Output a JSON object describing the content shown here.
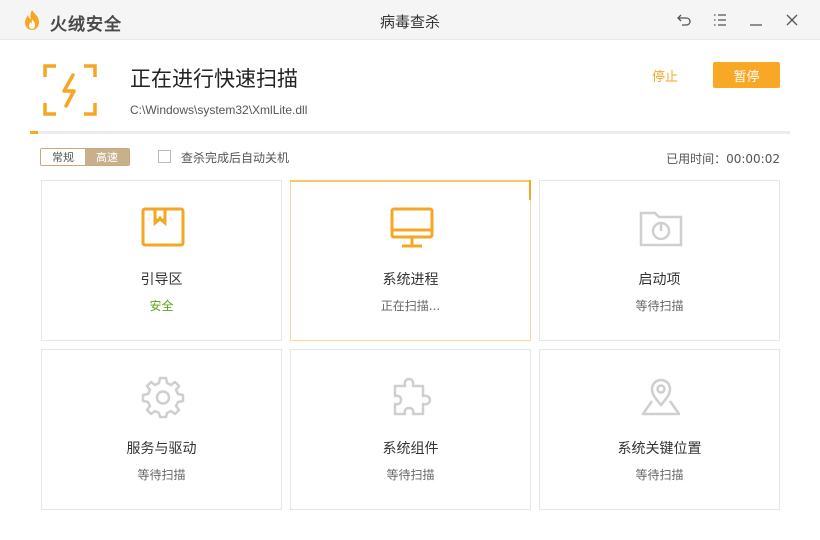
{
  "app": {
    "brand": "火绒安全",
    "window_title": "病毒查杀"
  },
  "scan": {
    "title": "正在进行快速扫描",
    "current_file": "C:\\Windows\\system32\\XmlLite.dll",
    "stop_label": "停止",
    "pause_label": "暂停",
    "progress_percent": 1
  },
  "options": {
    "mode_normal": "常规",
    "mode_fast": "高速",
    "selected_mode": "高速",
    "auto_shutdown_label": "查杀完成后自动关机",
    "auto_shutdown_checked": false,
    "elapsed_text": "已用时间：00:00:02"
  },
  "items": [
    {
      "name": "引导区",
      "status": "安全",
      "icon": "boot-sector-icon",
      "state": "safe"
    },
    {
      "name": "系统进程",
      "status": "正在扫描...",
      "icon": "monitor-icon",
      "state": "active"
    },
    {
      "name": "启动项",
      "status": "等待扫描",
      "icon": "startup-folder-icon",
      "state": "waiting"
    },
    {
      "name": "服务与驱动",
      "status": "等待扫描",
      "icon": "gear-icon",
      "state": "waiting"
    },
    {
      "name": "系统组件",
      "status": "等待扫描",
      "icon": "puzzle-icon",
      "state": "waiting"
    },
    {
      "name": "系统关键位置",
      "status": "等待扫描",
      "icon": "location-pin-icon",
      "state": "waiting"
    }
  ],
  "colors": {
    "accent": "#f5a623",
    "safe": "#5aa31a",
    "inactive_icon": "#cfcfcf"
  }
}
